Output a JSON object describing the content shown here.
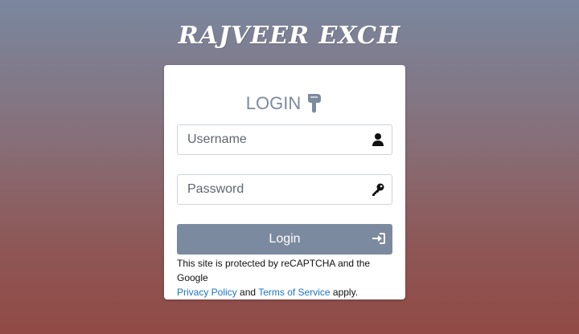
{
  "brand": {
    "title": "RAJVEER EXCH"
  },
  "login": {
    "heading": "LOGIN",
    "username_placeholder": "Username",
    "password_placeholder": "Password",
    "button_label": "Login"
  },
  "recaptcha": {
    "text_prefix": "This site is protected by reCAPTCHA and the Google",
    "privacy_link": "Privacy Policy",
    "and_text": "and",
    "terms_link": "Terms of Service",
    "suffix": "apply."
  },
  "icons": {
    "heading": "hand-pointing-down-icon",
    "username": "user-icon",
    "password": "key-icon",
    "button": "sign-in-icon"
  },
  "colors": {
    "accent": "#7c8aa0",
    "link": "#1a73c8"
  }
}
